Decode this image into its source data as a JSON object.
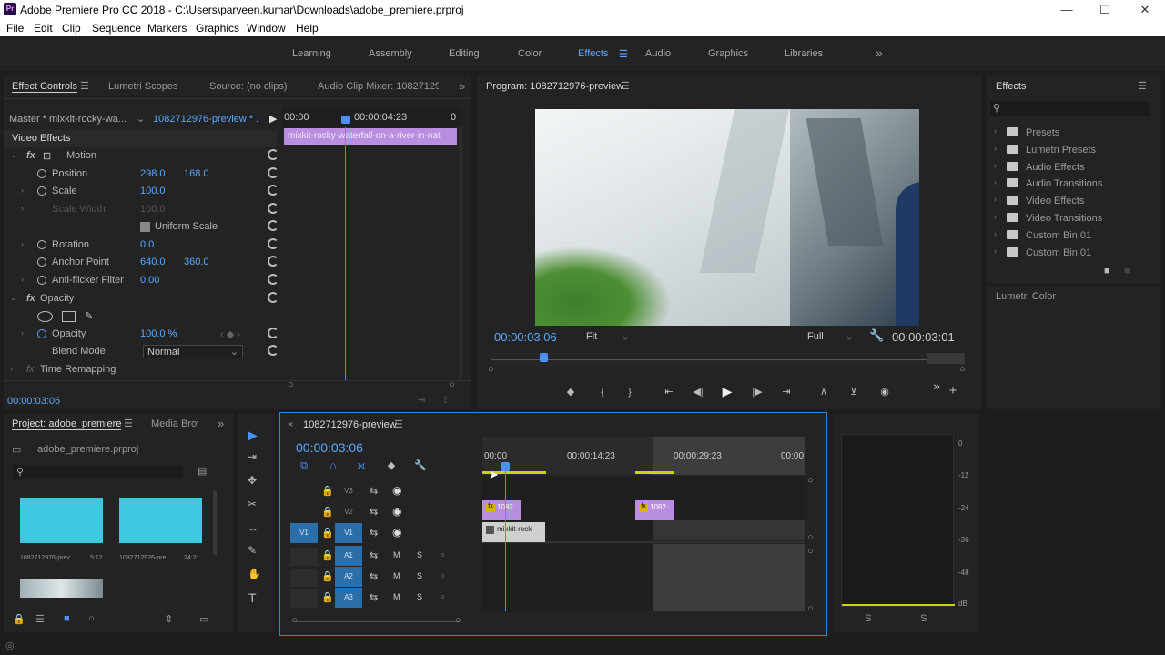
{
  "window": {
    "title": "Adobe Premiere Pro CC 2018 - C:\\Users\\parveen.kumar\\Downloads\\adobe_premiere.prproj",
    "logo": "Pr",
    "min": "—",
    "max": "☐",
    "close": "✕"
  },
  "menu": [
    "File",
    "Edit",
    "Clip",
    "Sequence",
    "Markers",
    "Graphics",
    "Window",
    "Help"
  ],
  "workspaces": {
    "items": [
      "Learning",
      "Assembly",
      "Editing",
      "Color",
      "Effects",
      "Audio",
      "Graphics",
      "Libraries"
    ],
    "active": "Effects",
    "more": "»"
  },
  "effect_controls": {
    "tabs": [
      "Effect Controls",
      "Lumetri Scopes",
      "Source: (no clips)",
      "Audio Clip Mixer: 1082712976"
    ],
    "master": "Master * mixkit-rocky-wa...",
    "sequence": "1082712976-preview * ...",
    "ruler_start": "00:00",
    "ruler_mid": "00:00:04:23",
    "ruler_end": "0",
    "clip_label": "mixkit-rocky-waterfall-on-a-river-in-nat",
    "section": "Video Effects",
    "motion": "Motion",
    "position": {
      "label": "Position",
      "x": "298.0",
      "y": "168.0"
    },
    "scale": {
      "label": "Scale",
      "v": "100.0"
    },
    "scale_width": {
      "label": "Scale Width",
      "v": "100.0"
    },
    "uniform": "Uniform Scale",
    "rotation": {
      "label": "Rotation",
      "v": "0.0"
    },
    "anchor": {
      "label": "Anchor Point",
      "x": "640.0",
      "y": "360.0"
    },
    "antiflicker": {
      "label": "Anti-flicker Filter",
      "v": "0.00"
    },
    "opacity_section": "Opacity",
    "opacity": {
      "label": "Opacity",
      "v": "100.0 %"
    },
    "blend": {
      "label": "Blend Mode",
      "v": "Normal"
    },
    "time_remap": "Time Remapping",
    "timecode": "00:00:03:06",
    "fx": "fx"
  },
  "program": {
    "title": "Program: 1082712976-preview",
    "timecode": "00:00:03:06",
    "fit": "Fit",
    "full": "Full",
    "duration": "00:00:03:01"
  },
  "effects_panel": {
    "title": "Effects",
    "items": [
      "Presets",
      "Lumetri Presets",
      "Audio Effects",
      "Audio Transitions",
      "Video Effects",
      "Video Transitions",
      "Custom Bin 01",
      "Custom Bin 01"
    ],
    "lumetri_color": "Lumetri Color"
  },
  "project": {
    "tabs": [
      "Project: adobe_premiere",
      "Media Brow"
    ],
    "file": "adobe_premiere.prproj",
    "clips": [
      {
        "name": "1082712976-prev...",
        "dur": "5:12"
      },
      {
        "name": "1082712976-pre...",
        "dur": "24:21"
      }
    ]
  },
  "timeline": {
    "tab": "1082712976-preview",
    "timecode": "00:00:03:06",
    "ruler": [
      "00:00",
      "00:00:14:23",
      "00:00:29:23",
      "00:00:"
    ],
    "tracks_v": [
      "V3",
      "V2",
      "V1"
    ],
    "tracks_a": [
      "A1",
      "A2",
      "A3"
    ],
    "src": "V1",
    "m": "M",
    "s": "S",
    "clip_v2": "1082",
    "clip_v2b": "1082",
    "clip_v1": "mixkit-rock"
  },
  "meters": {
    "labels": [
      "0",
      "-12",
      "-24",
      "-36",
      "-48",
      "dB"
    ],
    "s": "S"
  },
  "tools": [
    "▶",
    "⇥",
    "✥",
    "✂",
    "↔",
    "✎",
    "✋",
    "T"
  ]
}
